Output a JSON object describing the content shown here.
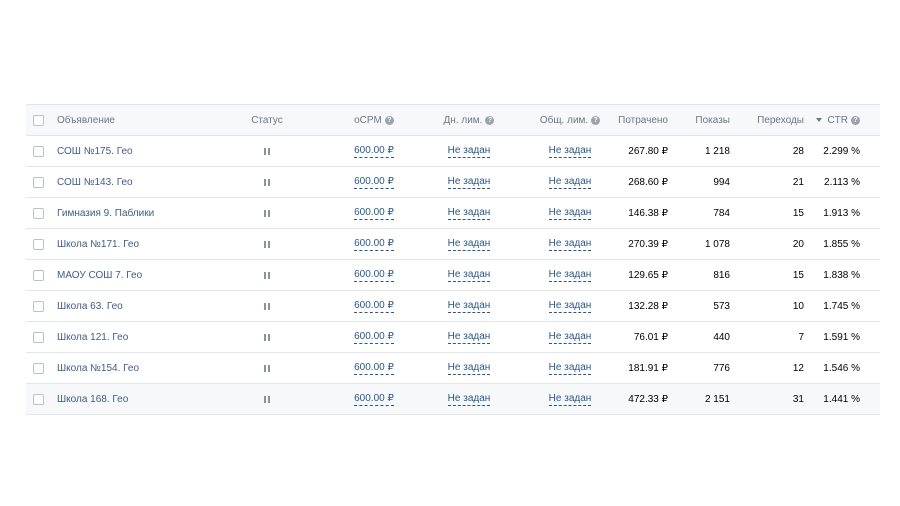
{
  "header": {
    "ad": "Объявление",
    "status": "Статус",
    "ocpm": "оCPM",
    "daily_limit": "Дн. лим.",
    "total_limit": "Общ. лим.",
    "spent": "Потрачено",
    "shows": "Показы",
    "clicks": "Переходы",
    "ctr": "CTR",
    "help_glyph": "?"
  },
  "icons": {
    "help": "help-circle-icon",
    "status": "pause-icon",
    "sort": "sort-down-icon"
  },
  "colors": {
    "link": "#2a5885",
    "header_bg": "#f7f8fa",
    "border": "#e3e5e8"
  },
  "rows": [
    {
      "name": "СОШ №175. Гео",
      "ocpm": "600.00 ₽",
      "daily_limit": "Не задан",
      "total_limit": "Не задан",
      "spent": "267.80 ₽",
      "shows": "1 218",
      "clicks": "28",
      "ctr": "2.299 %"
    },
    {
      "name": "СОШ №143. Гео",
      "ocpm": "600.00 ₽",
      "daily_limit": "Не задан",
      "total_limit": "Не задан",
      "spent": "268.60 ₽",
      "shows": "994",
      "clicks": "21",
      "ctr": "2.113 %"
    },
    {
      "name": "Гимназия 9. Паблики",
      "ocpm": "600.00 ₽",
      "daily_limit": "Не задан",
      "total_limit": "Не задан",
      "spent": "146.38 ₽",
      "shows": "784",
      "clicks": "15",
      "ctr": "1.913 %"
    },
    {
      "name": "Школа №171. Гео",
      "ocpm": "600.00 ₽",
      "daily_limit": "Не задан",
      "total_limit": "Не задан",
      "spent": "270.39 ₽",
      "shows": "1 078",
      "clicks": "20",
      "ctr": "1.855 %"
    },
    {
      "name": "МАОУ СОШ 7. Гео",
      "ocpm": "600.00 ₽",
      "daily_limit": "Не задан",
      "total_limit": "Не задан",
      "spent": "129.65 ₽",
      "shows": "816",
      "clicks": "15",
      "ctr": "1.838 %"
    },
    {
      "name": "Школа 63. Гео",
      "ocpm": "600.00 ₽",
      "daily_limit": "Не задан",
      "total_limit": "Не задан",
      "spent": "132.28 ₽",
      "shows": "573",
      "clicks": "10",
      "ctr": "1.745 %"
    },
    {
      "name": "Школа 121. Гео",
      "ocpm": "600.00 ₽",
      "daily_limit": "Не задан",
      "total_limit": "Не задан",
      "spent": "76.01 ₽",
      "shows": "440",
      "clicks": "7",
      "ctr": "1.591 %"
    },
    {
      "name": "Школа №154. Гео",
      "ocpm": "600.00 ₽",
      "daily_limit": "Не задан",
      "total_limit": "Не задан",
      "spent": "181.91 ₽",
      "shows": "776",
      "clicks": "12",
      "ctr": "1.546 %"
    },
    {
      "name": "Школа 168. Гео",
      "ocpm": "600.00 ₽",
      "daily_limit": "Не задан",
      "total_limit": "Не задан",
      "spent": "472.33 ₽",
      "shows": "2 151",
      "clicks": "31",
      "ctr": "1.441 %"
    }
  ]
}
